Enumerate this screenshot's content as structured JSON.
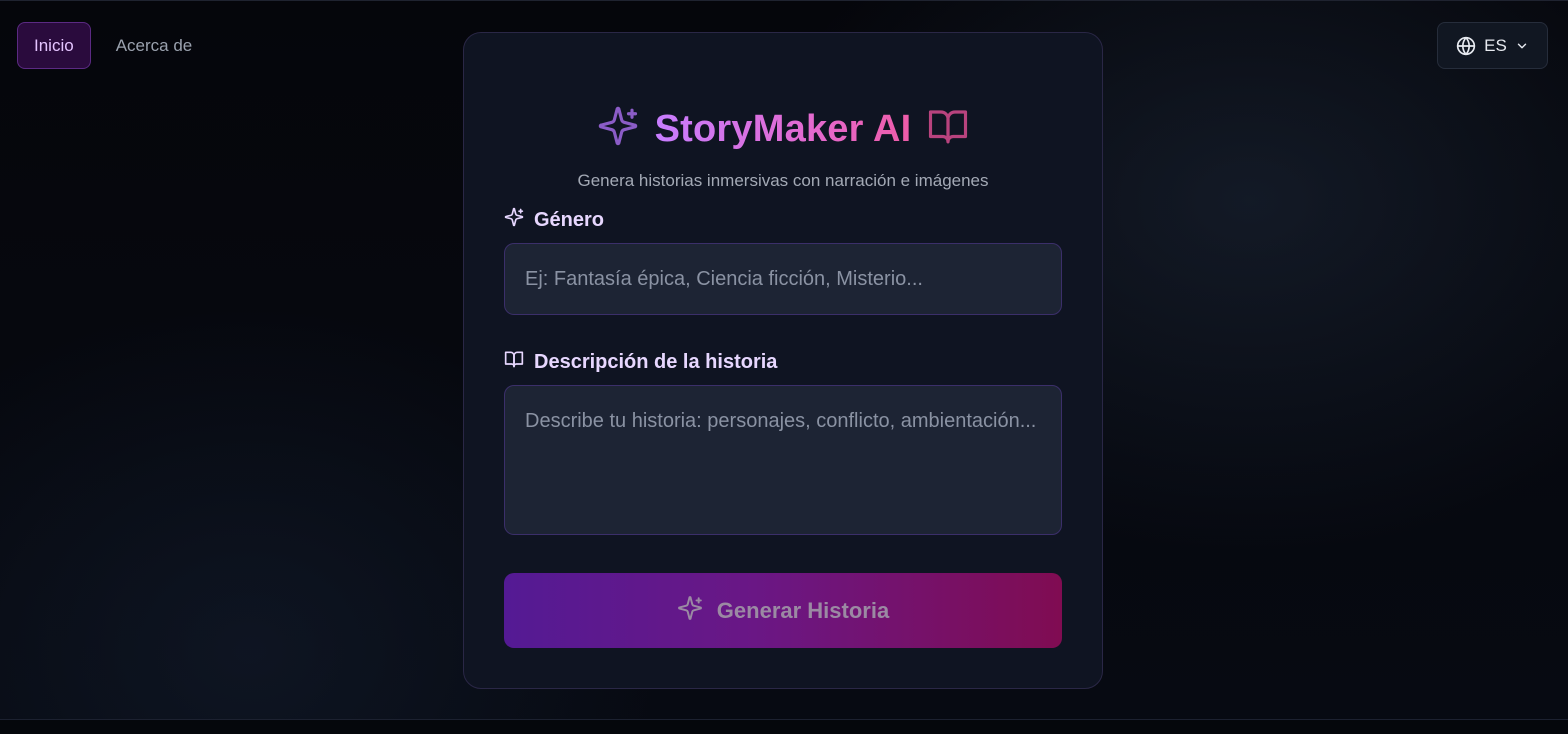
{
  "nav": {
    "items": [
      {
        "label": "Inicio",
        "active": true
      },
      {
        "label": "Acerca de",
        "active": false
      }
    ]
  },
  "language": {
    "code": "ES",
    "icon": "globe-icon"
  },
  "card": {
    "title": "StoryMaker AI",
    "subtitle": "Genera historias inmersivas con narración e imágenes",
    "genre": {
      "label": "Género",
      "placeholder": "Ej: Fantasía épica, Ciencia ficción, Misterio...",
      "value": ""
    },
    "description": {
      "label": "Descripción de la historia",
      "placeholder": "Describe tu historia: personajes, conflicto, ambientación...",
      "value": ""
    },
    "generate_label": "Generar Historia"
  },
  "colors": {
    "accent_purple": "#c77dff",
    "accent_pink": "#ee5ca8",
    "card_bg": "#0f1422",
    "input_bg": "#1d2434"
  }
}
